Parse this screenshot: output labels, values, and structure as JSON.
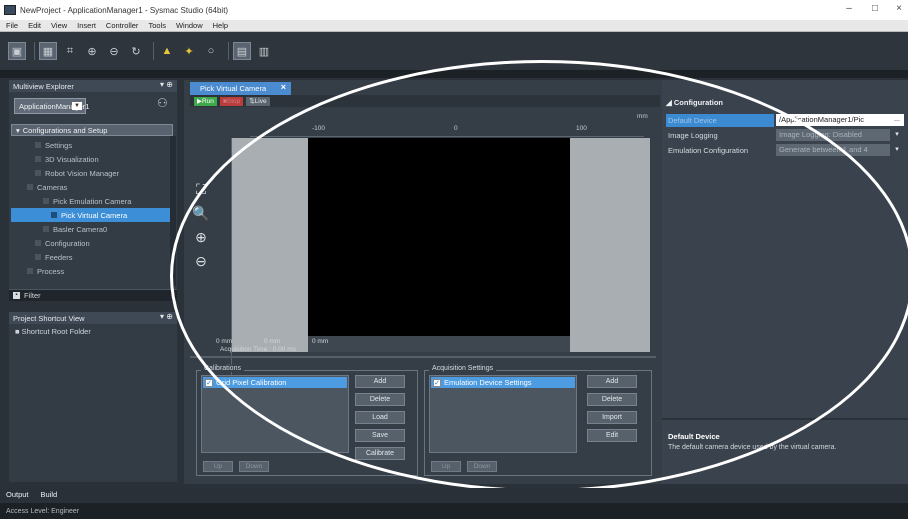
{
  "window": {
    "title": "NewProject - ApplicationManager1 - Sysmac Studio (64bit)",
    "controls": [
      "–",
      "□",
      "×"
    ]
  },
  "menu": [
    "File",
    "Edit",
    "View",
    "Insert",
    "Controller",
    "Tools",
    "Window",
    "Help"
  ],
  "multiview": {
    "title": "Multiview Explorer",
    "pin": "▾ ⊕",
    "app_selector": "ApplicationManager1",
    "tree_root": "Configurations and Setup",
    "items": [
      {
        "label": "Settings",
        "indent": 1
      },
      {
        "label": "3D Visualization",
        "indent": 1
      },
      {
        "label": "Robot Vision Manager",
        "indent": 1
      },
      {
        "label": "Cameras",
        "indent": 0
      },
      {
        "label": "Pick Emulation Camera",
        "indent": 2
      },
      {
        "label": "Pick Virtual Camera",
        "indent": 3,
        "selected": true
      },
      {
        "label": "Basler Camera0",
        "indent": 2
      },
      {
        "label": "Configuration",
        "indent": 1
      },
      {
        "label": "Feeders",
        "indent": 1
      },
      {
        "label": "Process",
        "indent": 0
      }
    ],
    "filter_label": "Filter"
  },
  "shortcut": {
    "title": "Project Shortcut View",
    "pin": "▾ ⊕",
    "item": "Shortcut Root Folder"
  },
  "editor": {
    "tab_label": "Pick Virtual Camera",
    "tab_close": "×",
    "run": "▶Run",
    "stop": "■Stop",
    "live": "⇅Live",
    "unit": "mm",
    "ruler_ticks": [
      "-100",
      "0",
      "100"
    ],
    "pos_x": "0 mm",
    "pos_y": "0 mm",
    "pos_z": "0 mm",
    "acquisition_time": "Acquisition Time : 0.00 ms",
    "calibrations": {
      "title": "Calibrations",
      "list": [
        "Grid Pixel Calibration"
      ],
      "buttons": [
        "Add",
        "Delete",
        "Load",
        "Save",
        "Calibrate"
      ],
      "up": "Up",
      "down": "Down"
    },
    "acquisition": {
      "title": "Acquisition Settings",
      "list": [
        "Emulation Device Settings"
      ],
      "buttons": [
        "Add",
        "Delete",
        "Import",
        "Edit"
      ],
      "up": "Up",
      "down": "Down"
    }
  },
  "properties": {
    "category": "Configuration",
    "rows": [
      {
        "key": "Default Device",
        "value": "/ApplicationManager1/Pic",
        "selected": true,
        "button": "..."
      },
      {
        "key": "Image Logging",
        "value": "Image Logging: Disabled",
        "dropdown": "▾"
      },
      {
        "key": "Emulation Configuration",
        "value": "Generate between 1 and 4",
        "dropdown": "▾"
      }
    ],
    "desc_title": "Default Device",
    "desc_text": "The default camera device used by the virtual camera."
  },
  "bottom_tabs": [
    "Output",
    "Build"
  ],
  "status": "Access Level: Engineer"
}
